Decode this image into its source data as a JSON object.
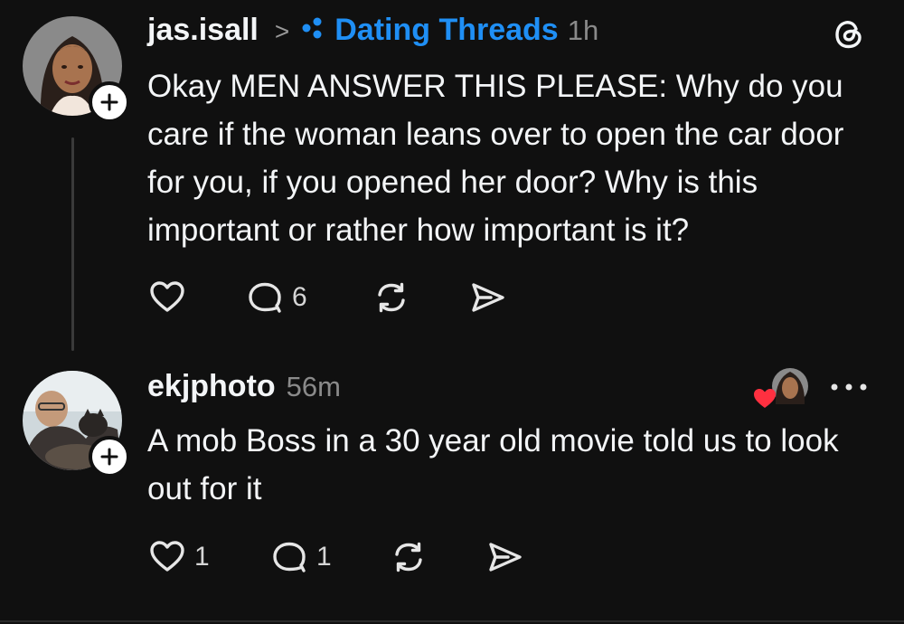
{
  "colors": {
    "background": "#101010",
    "text": "#f3f5f7",
    "muted": "#8a8a8a",
    "accent_blue": "#1f8ff5",
    "like_red": "#ff3040"
  },
  "post": {
    "username": "jas.isall",
    "separator": ">",
    "topic": "Dating Threads",
    "topic_icon": "topic-dots-icon",
    "time": "1h",
    "text": "Okay MEN ANSWER THIS PLEASE: Why do you care if the woman leans over to open the car door for you, if you opened her door? Why is this important or rather how important is it?",
    "actions": {
      "like_count": "",
      "reply_count": "6"
    }
  },
  "reply": {
    "username": "ekjphoto",
    "time": "56m",
    "text": "A mob Boss in a 30 year old movie told us to look out for it",
    "liked_by_author": true,
    "actions": {
      "like_count": "1",
      "reply_count": "1"
    }
  },
  "icons": {
    "app": "threads-logo-icon",
    "more": "more-horizontal-icon",
    "follow": "plus-icon",
    "like": "heart-icon",
    "reply": "comment-bubble-icon",
    "repost": "repost-icon",
    "share": "share-send-icon"
  }
}
